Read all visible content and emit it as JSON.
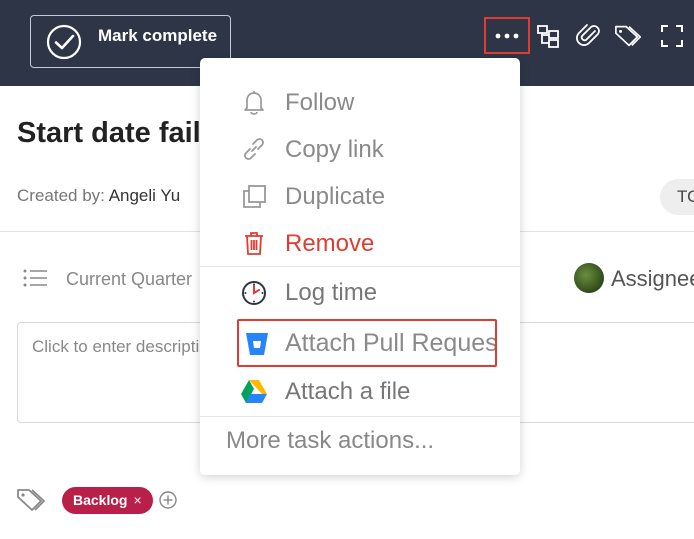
{
  "topbar": {
    "mark_complete_label": "Mark complete",
    "icons": [
      "more-options-icon",
      "subtasks-icon",
      "attachment-icon",
      "tags-icon",
      "fullscreen-icon"
    ]
  },
  "task": {
    "title": "Start date fail",
    "created_by_label": "Created by:",
    "created_by_name": "Angeli Yu",
    "status_pill": "TO",
    "section": "Current Quarter",
    "assignee_label": "Assignee",
    "description_placeholder": "Click to enter description"
  },
  "tags": [
    {
      "label": "Backlog",
      "remove": "×",
      "color": "#b8204a"
    }
  ],
  "menu": {
    "items": [
      {
        "label": "Follow",
        "icon": "bell-icon"
      },
      {
        "label": "Copy link",
        "icon": "link-icon"
      },
      {
        "label": "Duplicate",
        "icon": "duplicate-icon"
      },
      {
        "label": "Remove",
        "icon": "trash-icon",
        "color": "#e03c31"
      },
      {
        "label": "Log time",
        "icon": "clock-icon"
      },
      {
        "label": "Attach Pull Request",
        "icon": "bitbucket-icon"
      },
      {
        "label": "Attach a file",
        "icon": "google-drive-icon"
      }
    ],
    "more_label": "More task actions..."
  },
  "colors": {
    "topbar": "#2d3547",
    "highlight": "#e03c31",
    "remove": "#e03c31",
    "tag": "#b8204a"
  }
}
